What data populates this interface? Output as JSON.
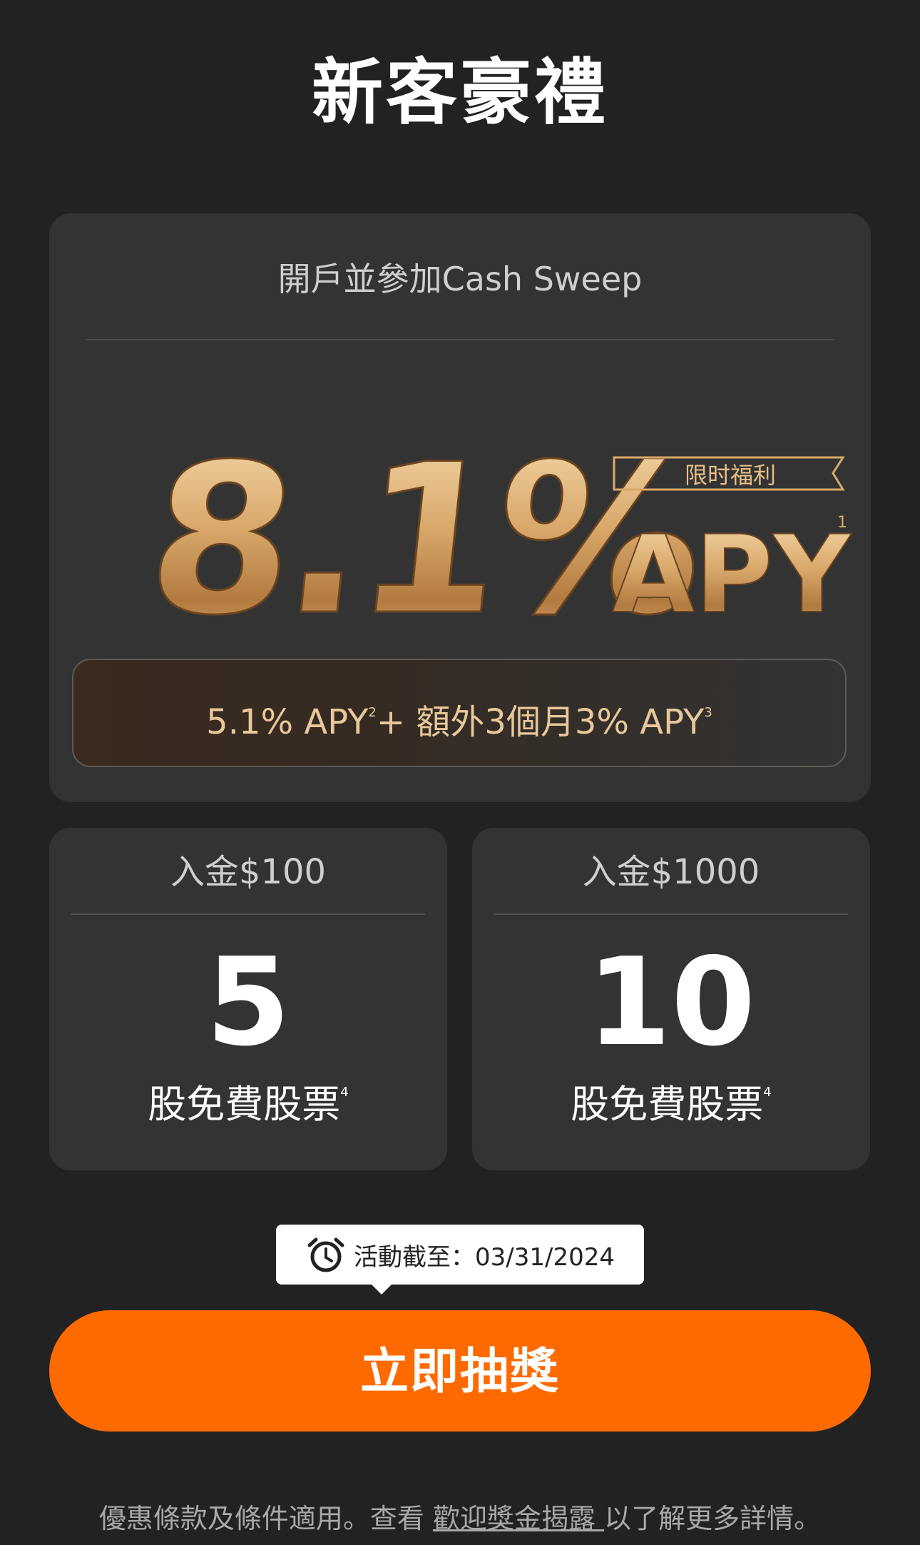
{
  "page_title": "新客豪禮",
  "promo_card": {
    "heading": "開戶並參加Cash Sweep",
    "hero_rate": "8.1%",
    "hero_apy": "APY",
    "hero_footnote": "1",
    "ribbon_label": "限时福利",
    "breakdown": {
      "part1": "5.1% APY",
      "sup1": "2",
      "part2": "+ 額外3個月3% APY",
      "sup2": "3"
    }
  },
  "reward_cards": [
    {
      "deposit_label": "入金$100",
      "shares_count": "5",
      "shares_label": "股免費股票",
      "footnote": "4"
    },
    {
      "deposit_label": "入金$1000",
      "shares_count": "10",
      "shares_label": "股免費股票",
      "footnote": "4"
    }
  ],
  "deadline_tooltip": {
    "icon": "alarm-clock-icon",
    "text": "活動截至：03/31/2024"
  },
  "cta_button": {
    "label": "立即抽獎"
  },
  "footer": {
    "text_before": "優惠條款及條件適用。查看 ",
    "link_text": "歡迎獎金揭露 ",
    "text_after": "以了解更多詳情。"
  },
  "colors": {
    "background": "#222222",
    "card": "#333333",
    "accent_orange": "#ff6a00",
    "gold": "#d9a86a",
    "breakdown_text": "#e8c89a"
  }
}
